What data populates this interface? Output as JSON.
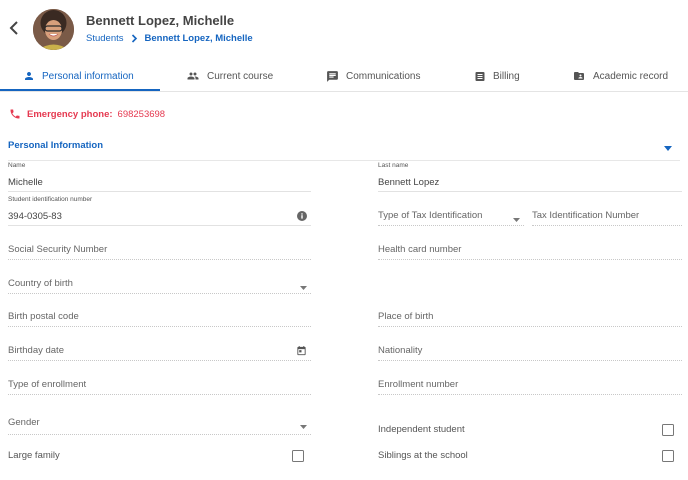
{
  "header": {
    "title": "Bennett Lopez, Michelle",
    "breadcrumb": {
      "root": "Students",
      "current": "Bennett Lopez, Michelle"
    }
  },
  "tabs": [
    {
      "label": "Personal information",
      "icon": "person-icon",
      "active": true
    },
    {
      "label": "Current course",
      "icon": "people-icon"
    },
    {
      "label": "Communications",
      "icon": "chat-icon"
    },
    {
      "label": "Billing",
      "icon": "billing-icon"
    },
    {
      "label": "Academic record",
      "icon": "folder-account-icon"
    }
  ],
  "emergency": {
    "label": "Emergency phone:",
    "value": "698253698",
    "color": "#e53950"
  },
  "section": {
    "title": "Personal Information"
  },
  "fields": {
    "name": {
      "label": "Name",
      "value": "Michelle"
    },
    "last_name": {
      "label": "Last name",
      "value": "Bennett Lopez"
    },
    "student_id": {
      "label": "Student identification number",
      "value": "394-0305-83"
    },
    "tax_type": {
      "placeholder": "Type of Tax Identification"
    },
    "tax_number": {
      "placeholder": "Tax Identification Number"
    },
    "ssn": {
      "placeholder": "Social Security Number"
    },
    "health_card": {
      "placeholder": "Health card number"
    },
    "country_of_birth": {
      "placeholder": "Country of birth"
    },
    "birth_postal_code": {
      "placeholder": "Birth postal code"
    },
    "place_of_birth": {
      "placeholder": "Place of birth"
    },
    "birthday": {
      "placeholder": "Birthday date"
    },
    "nationality": {
      "placeholder": "Nationality"
    },
    "enrollment_type": {
      "placeholder": "Type of enrollment"
    },
    "enrollment_number": {
      "placeholder": "Enrollment number"
    },
    "gender": {
      "placeholder": "Gender"
    }
  },
  "checkboxes": {
    "independent_student": {
      "label": "Independent student",
      "checked": false
    },
    "large_family": {
      "label": "Large family",
      "checked": false
    },
    "siblings": {
      "label": "Siblings at the school",
      "checked": false
    }
  },
  "colors": {
    "accent": "#1565c0",
    "alert": "#e53950"
  }
}
